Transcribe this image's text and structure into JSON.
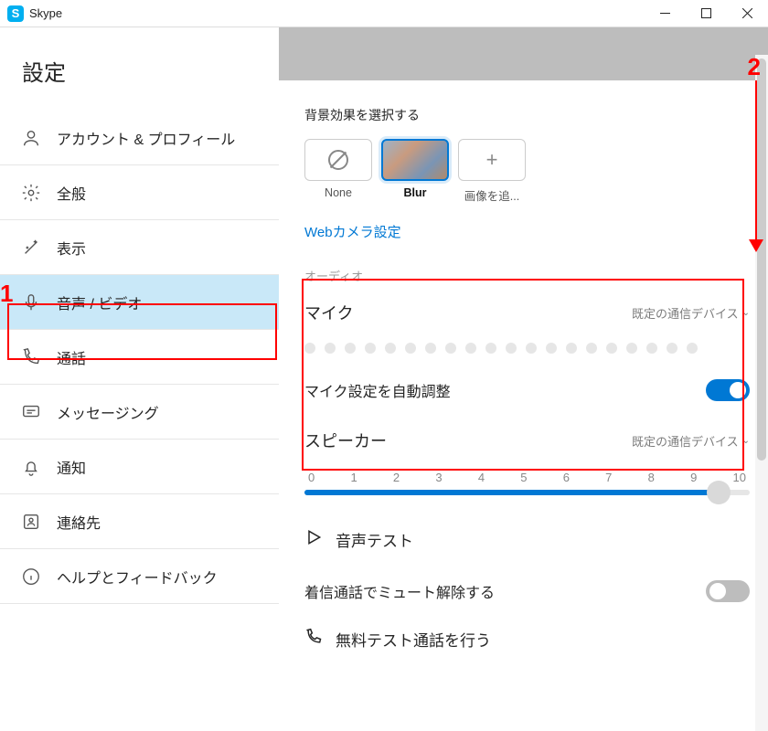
{
  "titlebar": {
    "app_name": "Skype"
  },
  "sidebar": {
    "title": "設定",
    "items": [
      {
        "label": "アカウント & プロフィール",
        "icon": "user-icon"
      },
      {
        "label": "全般",
        "icon": "gear-icon"
      },
      {
        "label": "表示",
        "icon": "wand-icon"
      },
      {
        "label": "音声 / ビデオ",
        "icon": "mic-icon",
        "active": true
      },
      {
        "label": "通話",
        "icon": "phone-icon"
      },
      {
        "label": "メッセージング",
        "icon": "chat-icon"
      },
      {
        "label": "通知",
        "icon": "bell-icon"
      },
      {
        "label": "連絡先",
        "icon": "contacts-icon"
      },
      {
        "label": "ヘルプとフィードバック",
        "icon": "info-icon"
      }
    ]
  },
  "main": {
    "bg_section_label": "背景効果を選択する",
    "bg_options": {
      "none": "None",
      "blur": "Blur",
      "add_image": "画像を追..."
    },
    "webcam_link": "Webカメラ設定",
    "audio": {
      "heading": "オーディオ",
      "mic_label": "マイク",
      "mic_device": "既定の通信デバイス",
      "auto_adjust_label": "マイク設定を自動調整",
      "auto_adjust_on": true,
      "speaker_label": "スピーカー",
      "speaker_device": "既定の通信デバイス",
      "speaker_volume": 10,
      "ticks": [
        "0",
        "1",
        "2",
        "3",
        "4",
        "5",
        "6",
        "7",
        "8",
        "9",
        "10"
      ],
      "test_label": "音声テスト",
      "unmute_incoming_label": "着信通話でミュート解除する",
      "unmute_incoming_on": false,
      "free_test_call_label": "無料テスト通話を行う"
    }
  },
  "annotations": {
    "a1": "1",
    "a2": "2"
  }
}
